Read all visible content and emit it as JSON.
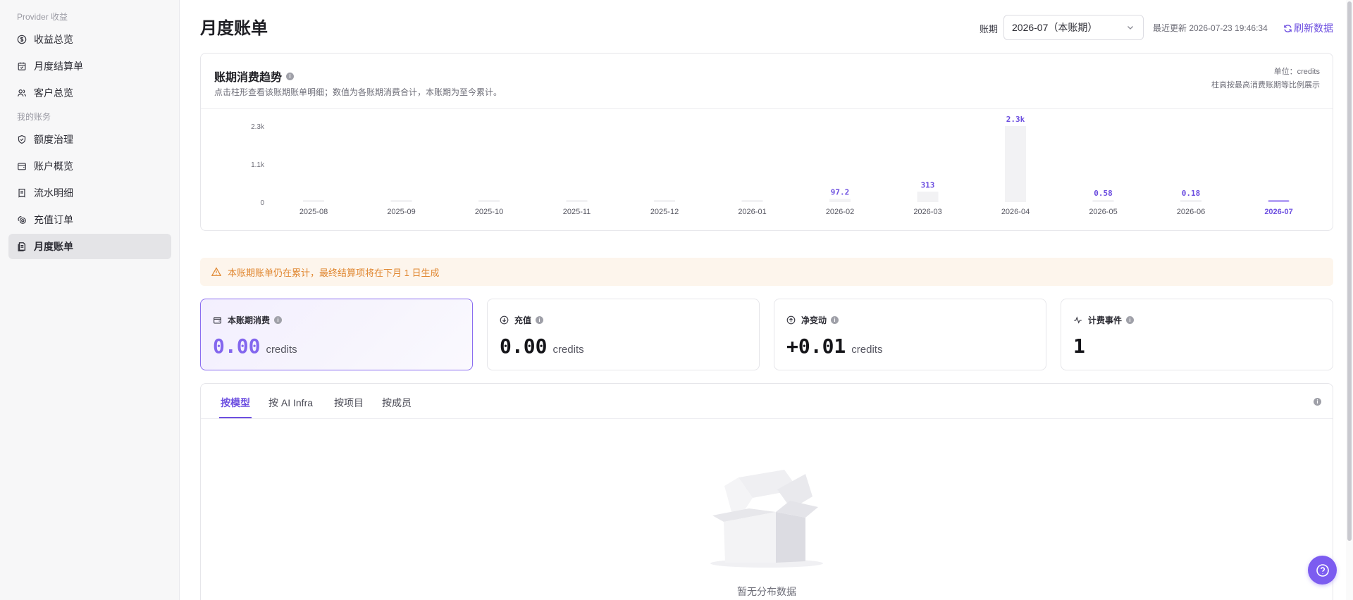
{
  "sidebar": {
    "groups": [
      {
        "label": "Provider 收益"
      },
      {
        "label": "我的账务"
      }
    ],
    "items": [
      {
        "label": "收益总览",
        "icon": "dollar-circle-icon"
      },
      {
        "label": "月度结算单",
        "icon": "calendar-check-icon"
      },
      {
        "label": "客户总览",
        "icon": "users-icon"
      },
      {
        "label": "额度治理",
        "icon": "shield-icon"
      },
      {
        "label": "账户概览",
        "icon": "wallet-icon"
      },
      {
        "label": "流水明细",
        "icon": "receipt-icon"
      },
      {
        "label": "充值订单",
        "icon": "coins-icon"
      },
      {
        "label": "月度账单",
        "icon": "bill-icon",
        "active": true
      }
    ]
  },
  "header": {
    "title": "月度账单",
    "period_label": "账期",
    "period_value": "2026-07（本账期）",
    "updated_text": "最近更新 2026-07-23 19:46:34",
    "refresh_label": "刷新数据"
  },
  "trend": {
    "title": "账期消费趋势",
    "description": "点击柱形查看该账期账单明细；数值为各账期消费合计，本账期为至今累计。",
    "unit": "单位：credits",
    "note": "柱高按最高消费账期等比例展示"
  },
  "chart_data": {
    "type": "bar",
    "categories": [
      "2025-08",
      "2025-09",
      "2025-10",
      "2025-11",
      "2025-12",
      "2026-01",
      "2026-02",
      "2026-03",
      "2026-04",
      "2026-05",
      "2026-06",
      "2026-07"
    ],
    "values": [
      0,
      0,
      0,
      0,
      0,
      0,
      97.2,
      313,
      2300,
      0.58,
      0.18,
      0
    ],
    "data_labels": [
      "",
      "",
      "",
      "",
      "",
      "",
      "97.2",
      "313",
      "2.3k",
      "0.58",
      "0.18",
      ""
    ],
    "yticks": [
      "0",
      "1.1k",
      "2.3k"
    ],
    "ytick_values": [
      0,
      1150,
      2300
    ],
    "ylim": [
      0,
      2300
    ],
    "highlight_category": "2026-07",
    "bar_color": "#f2f2f4",
    "accent_color": "#6d4fe0"
  },
  "banner": {
    "text": "本账期账单仍在累计，最终结算项将在下月 1 日生成"
  },
  "stats": [
    {
      "label": "本账期消费",
      "value": "0.00",
      "unit": "credits",
      "icon": "wallet-icon",
      "active": true
    },
    {
      "label": "充值",
      "value": "0.00",
      "unit": "credits",
      "icon": "download-circle-icon"
    },
    {
      "label": "净变动",
      "value": "+0.01",
      "unit": "credits",
      "icon": "upload-circle-icon"
    },
    {
      "label": "计费事件",
      "value": "1",
      "unit": "",
      "icon": "activity-icon"
    }
  ],
  "tabs": [
    {
      "label": "按模型",
      "active": true
    },
    {
      "label": "按 AI Infra"
    },
    {
      "label": "按项目"
    },
    {
      "label": "按成员"
    }
  ],
  "empty": {
    "text": "暂无分布数据"
  }
}
